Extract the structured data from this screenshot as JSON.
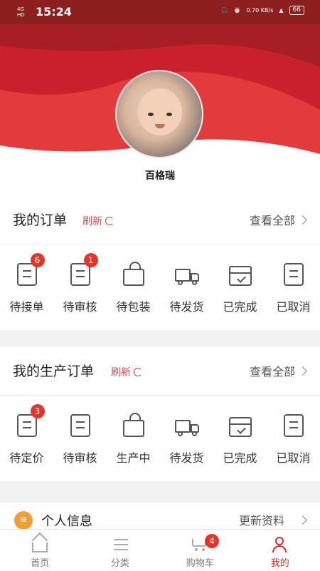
{
  "status_bar": {
    "network": "4G HD",
    "time": "15:24",
    "speed": "0.70 KB/s",
    "battery": "66"
  },
  "profile": {
    "name": "百格瑞"
  },
  "orders": {
    "title": "我的订单",
    "refresh": "刷新",
    "view_all": "查看全部",
    "items": [
      {
        "label": "待接单",
        "icon": "order-doc-icon",
        "badge": "6"
      },
      {
        "label": "待审核",
        "icon": "review-doc-icon",
        "badge": "1"
      },
      {
        "label": "待包装",
        "icon": "bag-icon",
        "badge": ""
      },
      {
        "label": "待发货",
        "icon": "truck-icon",
        "badge": ""
      },
      {
        "label": "已完成",
        "icon": "box-check-icon",
        "badge": ""
      },
      {
        "label": "已取消",
        "icon": "cancel-doc-icon",
        "badge": ""
      }
    ]
  },
  "production_orders": {
    "title": "我的生产订单",
    "refresh": "刷新",
    "view_all": "查看全部",
    "items": [
      {
        "label": "待定价",
        "icon": "order-doc-icon",
        "badge": "3"
      },
      {
        "label": "待审核",
        "icon": "review-doc-icon",
        "badge": ""
      },
      {
        "label": "生产中",
        "icon": "bag-icon",
        "badge": ""
      },
      {
        "label": "待发货",
        "icon": "truck-icon",
        "badge": ""
      },
      {
        "label": "已完成",
        "icon": "box-check-icon",
        "badge": ""
      },
      {
        "label": "已取消",
        "icon": "cancel-doc-icon",
        "badge": ""
      }
    ]
  },
  "personal_info": {
    "title": "个人信息",
    "update": "更新资料"
  },
  "tabbar": {
    "tabs": [
      {
        "label": "首页",
        "icon": "home-icon"
      },
      {
        "label": "分类",
        "icon": "list-icon"
      },
      {
        "label": "购物车",
        "icon": "cart-icon",
        "badge": "4"
      },
      {
        "label": "我的",
        "icon": "user-icon"
      }
    ]
  },
  "colors": {
    "brand_red": "#d42f2f",
    "badge_red": "#e8332a",
    "header_top": "#8e1f1f"
  }
}
